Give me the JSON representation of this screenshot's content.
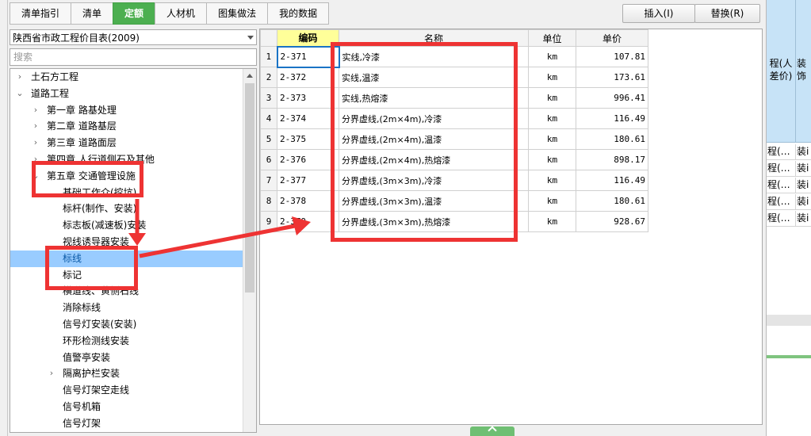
{
  "tabs": [
    {
      "label": "清单指引",
      "active": false
    },
    {
      "label": "清单",
      "active": false
    },
    {
      "label": "定额",
      "active": true
    },
    {
      "label": "人材机",
      "active": false
    },
    {
      "label": "图集做法",
      "active": false
    },
    {
      "label": "我的数据",
      "active": false
    }
  ],
  "buttons": {
    "insert": "插入(I)",
    "replace": "替换(R)"
  },
  "catalog_select": "陕西省市政工程价目表(2009)",
  "search_placeholder": "搜索",
  "tree": [
    {
      "label": "土石方工程",
      "level": 0,
      "chevron": "right"
    },
    {
      "label": "道路工程",
      "level": 0,
      "chevron": "down"
    },
    {
      "label": "第一章 路基处理",
      "level": 1,
      "chevron": "right"
    },
    {
      "label": "第二章 道路基层",
      "level": 1,
      "chevron": "right"
    },
    {
      "label": "第三章 道路面层",
      "level": 1,
      "chevron": "right"
    },
    {
      "label": "第四章 人行道侧石及其他",
      "level": 1,
      "chevron": "right"
    },
    {
      "label": "第五章 交通管理设施",
      "level": 1,
      "chevron": "down"
    },
    {
      "label": "基础工作介(挖坑)",
      "level": 2,
      "chevron": ""
    },
    {
      "label": "标杆(制作、安装)",
      "level": 2,
      "chevron": ""
    },
    {
      "label": "标志板(减速板)安装",
      "level": 2,
      "chevron": ""
    },
    {
      "label": "视线诱导器安装",
      "level": 2,
      "chevron": ""
    },
    {
      "label": "标线",
      "level": 2,
      "chevron": "",
      "selected": true
    },
    {
      "label": "标记",
      "level": 2,
      "chevron": ""
    },
    {
      "label": "横道线、黄侧石线",
      "level": 2,
      "chevron": ""
    },
    {
      "label": "消除标线",
      "level": 2,
      "chevron": ""
    },
    {
      "label": "信号灯安装(安装)",
      "level": 2,
      "chevron": ""
    },
    {
      "label": "环形检测线安装",
      "level": 2,
      "chevron": ""
    },
    {
      "label": "值警亭安装",
      "level": 2,
      "chevron": ""
    },
    {
      "label": "隔离护栏安装",
      "level": 2,
      "chevron": "right"
    },
    {
      "label": "信号灯架空走线",
      "level": 2,
      "chevron": ""
    },
    {
      "label": "信号机箱",
      "level": 2,
      "chevron": ""
    },
    {
      "label": "信号灯架",
      "level": 2,
      "chevron": ""
    }
  ],
  "table": {
    "headers": [
      "",
      "编码",
      "名称",
      "单位",
      "单价"
    ],
    "rows": [
      [
        "1",
        "2-371",
        "实线,冷漆",
        "km",
        "107.81"
      ],
      [
        "2",
        "2-372",
        "实线,温漆",
        "km",
        "173.61"
      ],
      [
        "3",
        "2-373",
        "实线,热熔漆",
        "km",
        "996.41"
      ],
      [
        "4",
        "2-374",
        "分界虚线,(2m×4m),冷漆",
        "km",
        "116.49"
      ],
      [
        "5",
        "2-375",
        "分界虚线,(2m×4m),温漆",
        "km",
        "180.61"
      ],
      [
        "6",
        "2-376",
        "分界虚线,(2m×4m),热熔漆",
        "km",
        "898.17"
      ],
      [
        "7",
        "2-377",
        "分界虚线,(3m×3m),冷漆",
        "km",
        "116.49"
      ],
      [
        "8",
        "2-378",
        "分界虚线,(3m×3m),温漆",
        "km",
        "180.61"
      ],
      [
        "9",
        "2-379",
        "分界虚线,(3m×3m),热熔漆",
        "km",
        "928.67"
      ]
    ]
  },
  "background_right": {
    "headers": [
      "程(人差价)",
      "装",
      "饰"
    ],
    "cells": [
      "程(…",
      "装i"
    ]
  },
  "colors": {
    "tab_active": "#4caf50",
    "selection": "#99ccff",
    "annotation": "#ee3333",
    "key_header": "#ffff99"
  }
}
